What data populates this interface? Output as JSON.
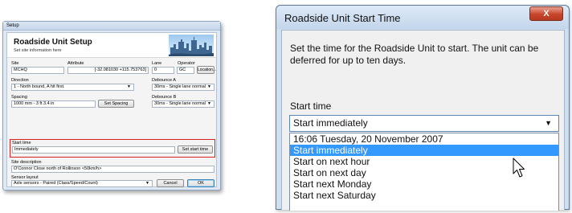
{
  "setup_dialog": {
    "window_title": "Setup",
    "header_title": "Roadside Unit Setup",
    "header_subtitle": "Set site information here",
    "site_label": "Site",
    "site_value": "MCHQ",
    "attribute_label": "Attribute",
    "attribute_value": "[-32.081030 +115.753763]",
    "lane_label": "Lane",
    "lane_value": "0",
    "operator_label": "Operator",
    "operator_value": "GC",
    "location_button": "Location...",
    "direction_label": "Direction",
    "direction_value": "1 - North bound, A hit first.",
    "debounce_a_label": "Debounce A",
    "debounce_a_value": "30ms - Single lane normal",
    "spacing_label": "Spacing",
    "spacing_value": "1000 mm - 3 ft 3.4 in",
    "set_spacing_button": "Set Spacing",
    "debounce_b_label": "Debounce B",
    "debounce_b_value": "30ms - Single lane normal",
    "start_time_label": "Start time",
    "start_time_value": "Immediately",
    "set_start_time_button": "Set start time",
    "site_description_label": "Site description",
    "site_description_value": "O'Connor Close north of Rollinson <50km/h>",
    "sensor_layout_label": "Sensor layout",
    "sensor_layout_value": "Axle sensors - Paired (Class/Speed/Count)",
    "cancel_button": "Cancel",
    "ok_button": "OK",
    "highlight_color": "#d82020"
  },
  "start_time_dialog": {
    "window_title": "Roadside Unit Start Time",
    "close_glyph": "X",
    "description": "Set the time for the Roadside Unit to start. The unit can be deferred for up to ten days.",
    "start_time_label": "Start time",
    "selected_value": "Start immediately",
    "options": [
      "16:06 Tuesday, 20 November 2007",
      "Start immediately",
      "Start on next hour",
      "Start on next day",
      "Start next Monday",
      "Start next Saturday"
    ],
    "highlighted_option_index": 1,
    "selection_color": "#3399ff"
  },
  "icons": {
    "dropdown_arrow": "chevron-down-icon",
    "pointer": "arrow-cursor-icon",
    "header_image": "city-skyline-icon"
  }
}
